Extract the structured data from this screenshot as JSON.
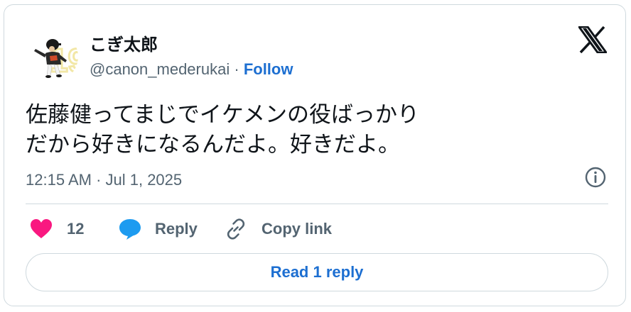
{
  "author": {
    "display_name": "こぎ太郎",
    "handle": "@canon_mederukai",
    "separator": "·",
    "follow_label": "Follow",
    "avatar_icon": "baseball-player-avatar"
  },
  "brand": {
    "logo_icon": "x-logo-icon"
  },
  "tweet": {
    "text_lines": [
      "佐藤健ってまじでイケメンの役ばっかり",
      "だから好きになるんだよ。好きだよ。"
    ],
    "timestamp": "12:15 AM · Jul 1, 2025",
    "info_icon": "info-icon"
  },
  "actions": {
    "like_count": "12",
    "reply_label": "Reply",
    "copy_label": "Copy link"
  },
  "read_reply_label": "Read 1 reply",
  "colors": {
    "accent": "#1d6fd1",
    "like": "#f91880",
    "reply_bubble": "#1d9bf0",
    "text": "#0f1419",
    "muted": "#536471",
    "border": "#cfd9de"
  }
}
